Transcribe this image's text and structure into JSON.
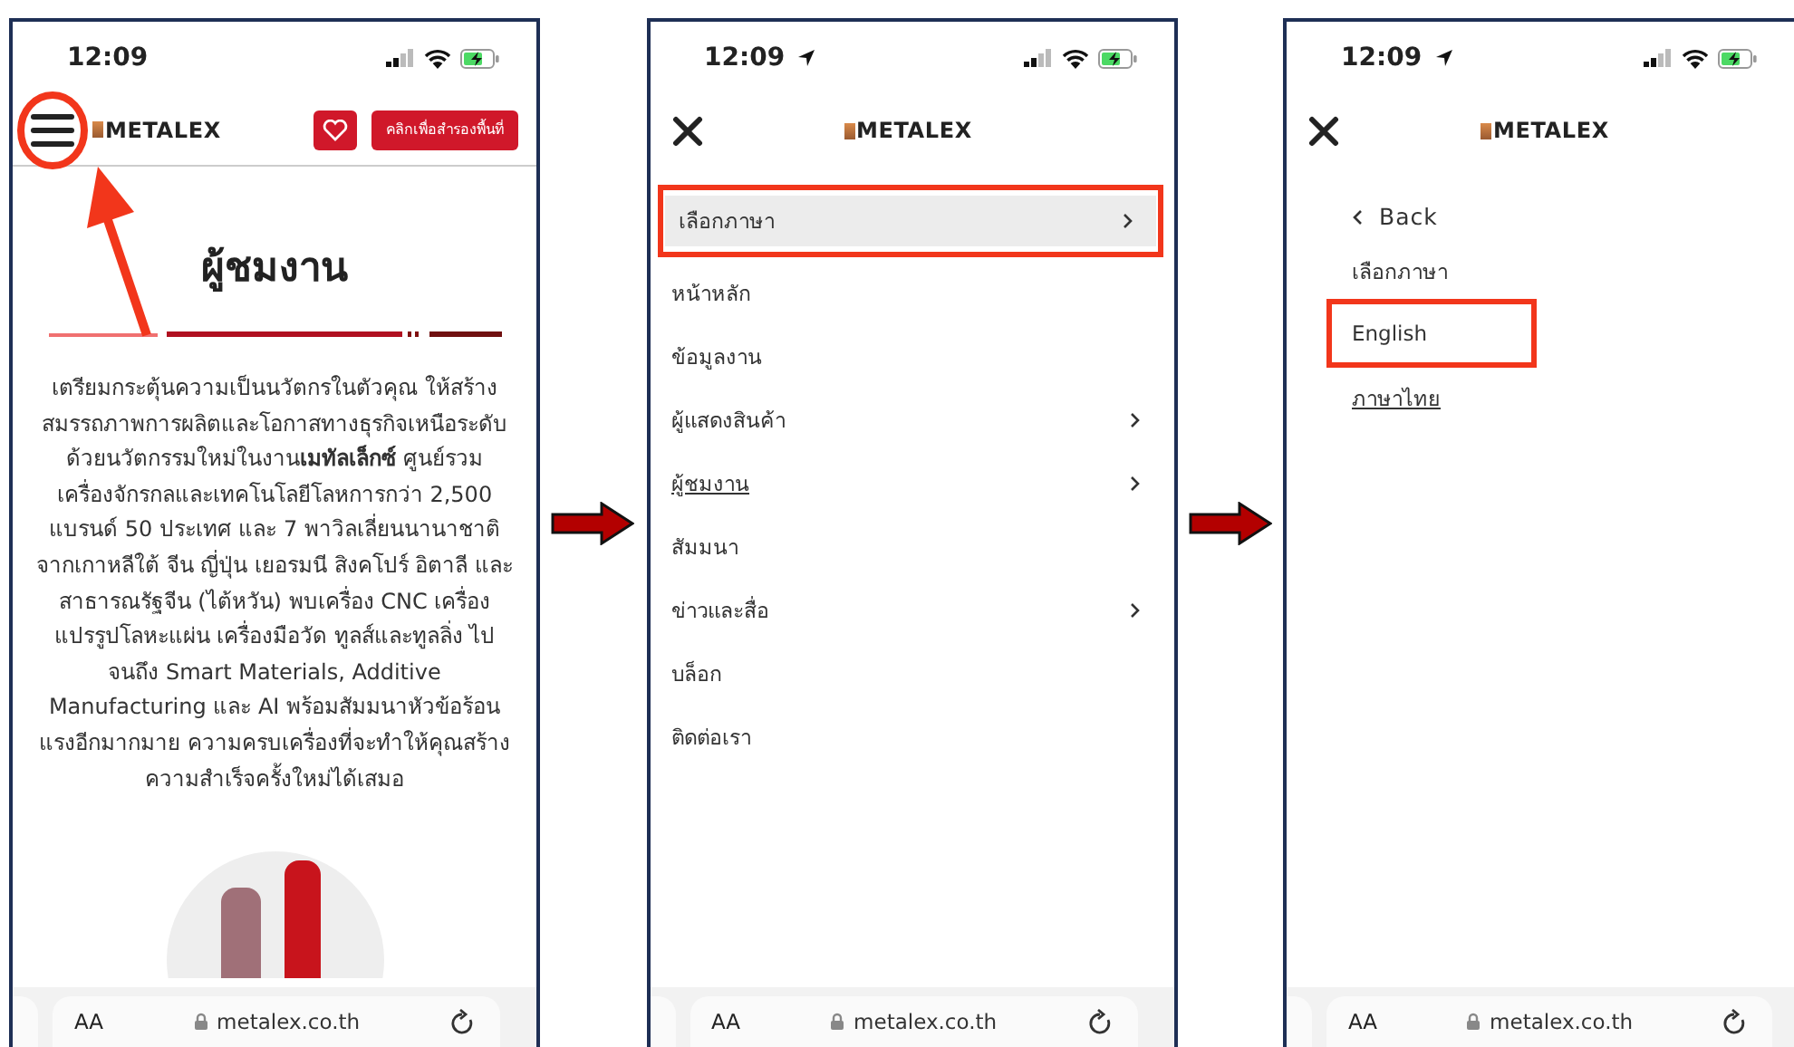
{
  "screens": [
    {
      "kind": "page",
      "time": "12:09",
      "location": false,
      "menu_callout": true,
      "brand": "METALEX",
      "cta": "คลิกเพื่อสำรองพื้นที่",
      "title": "ผู้ชมงาน",
      "paragraph": "เตรียมกระตุ้นความเป็นนวัตกรในตัวคุณ ให้สร้างสมรรถภาพการผลิตและโอกาสทางธุรกิจเหนือระดับด้วยนวัตกรรมใหม่ในงาน**เมทัลเล็กซ์** ศูนย์รวมเครื่องจักรกลและเทคโนโลยีโลหการกว่า 2,500 แบรนด์ 50 ประเทศ และ 7 พาวิลเลี่ยนนานาชาติจากเกาหลีใต้ จีน ญี่ปุ่น เยอรมนี สิงคโปร์ อิตาลี และสาธารณรัฐจีน (ไต้หวัน) พบเครื่อง CNC เครื่องแปรรูปโลหะแผ่น เครื่องมือวัด ทูลส์และทูลลิ่ง ไปจนถึง Smart Materials, Additive Manufacturing และ AI พร้อมสัมมนาหัวข้อร้อนแรงอีกมากมาย ความครบเครื่องที่จะทำให้คุณสร้างความสำเร็จครั้งใหม่ได้เสมอ",
      "address_bar": {
        "text_size": "AA",
        "url": "metalex.co.th"
      }
    },
    {
      "kind": "menu",
      "time": "12:09",
      "location": true,
      "brand": "METALEX",
      "items": [
        {
          "label": "เลือกภาษา",
          "submenu": true,
          "highlighted": true,
          "callout": true,
          "current": false
        },
        {
          "label": "หน้าหลัก",
          "submenu": false,
          "highlighted": false,
          "callout": false,
          "current": false
        },
        {
          "label": "ข้อมูลงาน",
          "submenu": false,
          "highlighted": false,
          "callout": false,
          "current": false
        },
        {
          "label": "ผู้แสดงสินค้า",
          "submenu": true,
          "highlighted": false,
          "callout": false,
          "current": false
        },
        {
          "label": "ผู้ชมงาน",
          "submenu": true,
          "highlighted": false,
          "callout": false,
          "current": true
        },
        {
          "label": "สัมมนา",
          "submenu": false,
          "highlighted": false,
          "callout": false,
          "current": false
        },
        {
          "label": "ข่าวและสื่อ",
          "submenu": true,
          "highlighted": false,
          "callout": false,
          "current": false
        },
        {
          "label": "บล็อก",
          "submenu": false,
          "highlighted": false,
          "callout": false,
          "current": false
        },
        {
          "label": "ติดต่อเรา",
          "submenu": false,
          "highlighted": false,
          "callout": false,
          "current": false
        }
      ],
      "address_bar": {
        "text_size": "AA",
        "url": "metalex.co.th"
      }
    },
    {
      "kind": "language",
      "time": "12:09",
      "location": true,
      "brand": "METALEX",
      "back": "Back",
      "heading": "เลือกภาษา",
      "options": [
        {
          "label": "English",
          "callout": true,
          "current": false
        },
        {
          "label": "ภาษาไทย",
          "callout": false,
          "current": true
        }
      ],
      "address_bar": {
        "text_size": "AA",
        "url": "metalex.co.th"
      }
    }
  ]
}
